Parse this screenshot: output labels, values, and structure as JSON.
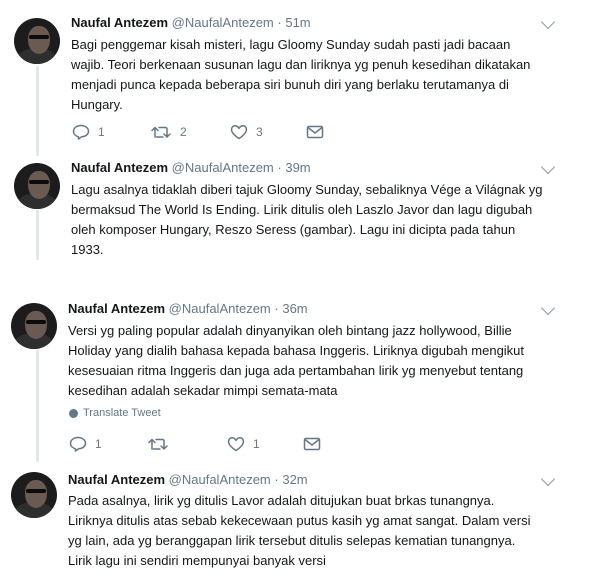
{
  "colors": {
    "icon": "#657786",
    "line": "#e1e8ed",
    "text": "#14171a",
    "meta": "#657786"
  },
  "tweets": [
    {
      "name": "Naufal Antezem",
      "handle": "@NaufalAntezem",
      "time": "51m",
      "lines": [
        "Bagi penggemar kisah misteri, lagu Gloomy Sunday sudah pasti jadi bacaan",
        "wajib. Teori berkenaan susunan lagu dan liriknya yg penuh kesedihan dikatakan",
        "menjadi punca kepada beberapa siri bunuh diri yang berlaku terutamanya di",
        "Hungary."
      ],
      "reply_count": "1",
      "retweet_count": "2",
      "like_count": "3"
    },
    {
      "name": "Naufal Antezem",
      "handle": "@NaufalAntezem",
      "time": "39m",
      "lines": [
        "Lagu asalnya tidaklah diberi tajuk Gloomy Sunday, sebaliknya Vége a Világnak yg",
        "bermaksud The World Is Ending. Lirik ditulis oleh Laszlo Javor dan lagu digubah",
        "oleh komposer Hungary, Reszo Seress (gambar). Lagu ini dicipta pada tahun",
        "1933."
      ]
    },
    {
      "name": "Naufal Antezem",
      "handle": "@NaufalAntezem",
      "time": "36m",
      "lines": [
        "Versi yg paling popular adalah dinyanyikan oleh bintang jazz hollywood, Billie",
        "Holiday yang dialih bahasa kepada bahasa Inggeris. Liriknya digubah mengikut",
        "kesesuaian ritma Inggeris dan juga ada pertambahan lirik yg menyebut tentang",
        "kesedihan adalah sekadar mimpi semata-mata"
      ],
      "translate_label": "Translate Tweet",
      "reply_count": "1",
      "retweet_count": "",
      "like_count": "1"
    },
    {
      "name": "Naufal Antezem",
      "handle": "@NaufalAntezem",
      "time": "32m",
      "lines": [
        "Pada asalnya, lirik yg ditulis Lavor adalah ditujukan buat brkas tunangnya.",
        "Liriknya ditulis atas sebab kekecewaan putus kasih yg amat sangat. Dalam versi",
        "yg lain, ada yg beranggapan lirik tersebut ditulis selepas kematian tunangnya.",
        "Lirik lagu ini sendiri mempunyai banyak versi"
      ]
    }
  ],
  "separator": "·"
}
